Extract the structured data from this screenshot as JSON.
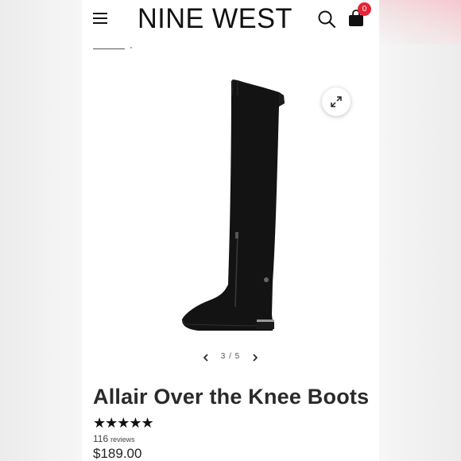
{
  "header": {
    "brand": "NINE WEST",
    "cart_count": "0"
  },
  "icons": {
    "menu": "hamburger-menu-icon",
    "search": "search-icon",
    "bag": "shopping-bag-icon",
    "expand": "expand-icon",
    "prev": "chevron-left-icon",
    "next": "chevron-right-icon"
  },
  "gallery": {
    "current": "3",
    "separator": "/",
    "total": "5"
  },
  "product": {
    "title": "Allair Over the Knee Boots",
    "rating": "★★★★★",
    "review_count": "116",
    "review_label": "reviews",
    "price": "$189.00"
  },
  "colors": {
    "badge": "#e32636",
    "text": "#2a2a2a",
    "background": "#ffffff"
  }
}
